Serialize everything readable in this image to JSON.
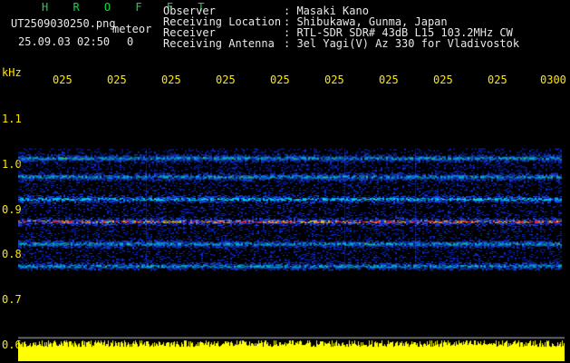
{
  "header": {
    "app_title": "H R O F F T",
    "filename": "UT2509030250.png",
    "meteor_label": "meteor",
    "timestamp": "25.09.03 02:50",
    "meteor_count": "0",
    "info": [
      {
        "label": "Observer",
        "value": ": Masaki Kano"
      },
      {
        "label": "Receiving Location",
        "value": ": Shibukawa, Gunma, Japan"
      },
      {
        "label": "Receiver",
        "value": ": RTL-SDR SDR# 43dB L15 103.2MHz CW"
      },
      {
        "label": "Receiving Antenna",
        "value": ": 3el Yagi(V) Az 330 for Vladivostok"
      }
    ]
  },
  "axis": {
    "unit": "kHz",
    "time_ticks": [
      "025",
      "025",
      "025",
      "025",
      "025",
      "025",
      "025",
      "025",
      "025",
      "0300"
    ],
    "freq_ticks": [
      "1.1",
      "1.0",
      "0.9",
      "0.8",
      "0.7",
      "0.6"
    ]
  },
  "colors": {
    "background": "#000000",
    "axis_text": "#ffe600",
    "title_text": "#00e040",
    "info_text": "#e8e8e8",
    "noise_floor": "#000a8c",
    "signal_strong": "#ff2020",
    "signal_mid": "#00c8ff",
    "signal_weak": "#1838ff",
    "power_bar": "#ffff00"
  },
  "signal_bands_khz": [
    1.017,
    0.975,
    0.925,
    0.875,
    0.825,
    0.775
  ]
}
